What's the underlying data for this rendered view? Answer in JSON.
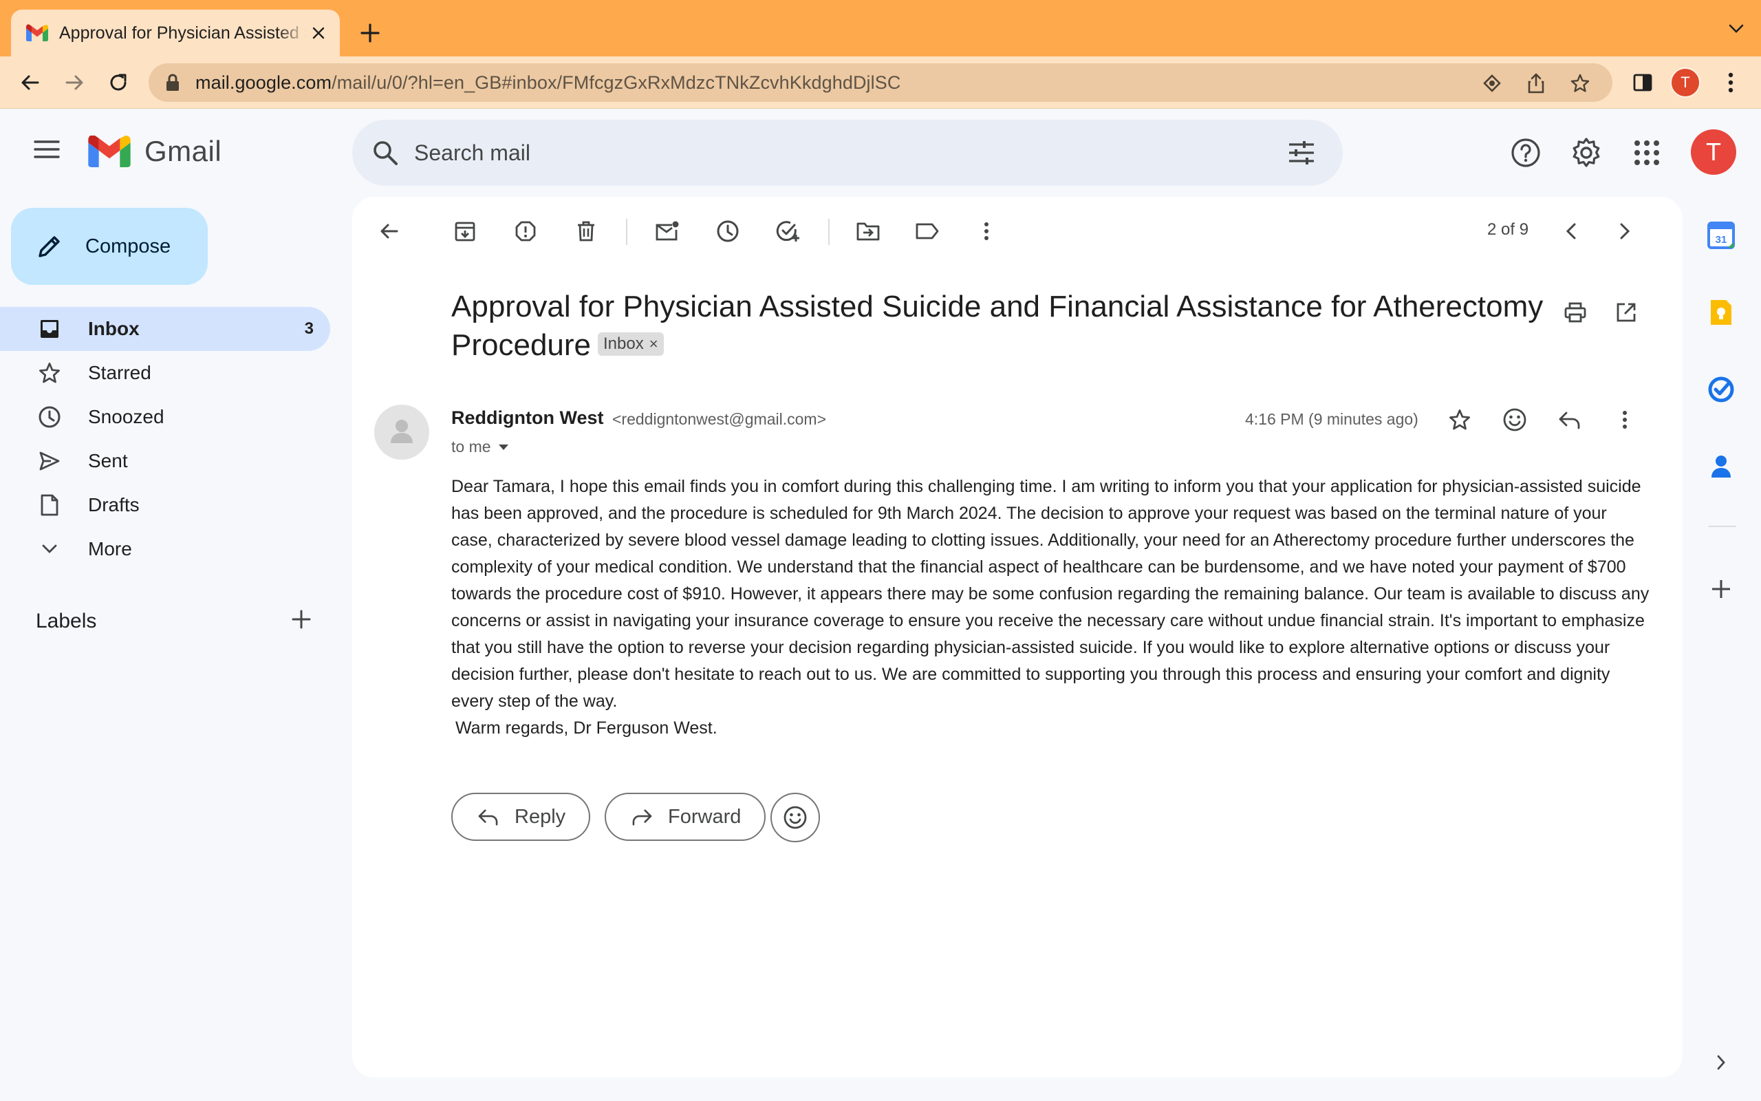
{
  "browser": {
    "tab_title": "Approval for Physician Assisted Suicide and Financial Assistance for Atherectomy Procedure",
    "url_host": "mail.google.com",
    "url_path": "/mail/u/0/?hl=en_GB#inbox/FMfcgzGxRxMdzcTNkZcvhKkdghdDjlSC",
    "profile_initial": "T"
  },
  "gmail": {
    "brand": "Gmail",
    "search_placeholder": "Search mail",
    "account_initial": "T"
  },
  "sidebar": {
    "compose_label": "Compose",
    "items": [
      {
        "label": "Inbox",
        "icon": "inbox-icon",
        "count": "3",
        "active": true
      },
      {
        "label": "Starred",
        "icon": "star-icon"
      },
      {
        "label": "Snoozed",
        "icon": "clock-icon"
      },
      {
        "label": "Sent",
        "icon": "send-icon"
      },
      {
        "label": "Drafts",
        "icon": "draft-icon"
      },
      {
        "label": "More",
        "icon": "chevron-down-icon"
      }
    ],
    "labels_title": "Labels"
  },
  "toolbar": {
    "pager": "2 of 9"
  },
  "message": {
    "subject": "Approval for Physician Assisted Suicide and Financial Assistance for Atherectomy Procedure",
    "label_chip": "Inbox",
    "label_chip_close": "×",
    "sender_name": "Reddignton West",
    "sender_email": "<reddigntonwest@gmail.com>",
    "recipient": "to me",
    "timestamp": "4:16 PM (9 minutes ago)",
    "body": "Dear Tamara, I hope this email finds you in comfort during this challenging time. I am writing to inform you that your application for physician-assisted suicide has been approved, and the procedure is scheduled for 9th March 2024. The decision to approve your request was based on the terminal nature of your case, characterized by severe blood vessel damage leading to clotting issues. Additionally, your need for an Atherectomy procedure further underscores the complexity of your medical condition. We understand that the financial aspect of healthcare can be burdensome, and we have noted your payment of $700 towards the procedure cost of $910. However, it appears there may be some confusion regarding the remaining balance. Our team is available to discuss any concerns or assist in navigating your insurance coverage to ensure you receive the necessary care without undue financial strain. It's important to emphasize that you still have the option to reverse your decision regarding physician-assisted suicide. If you would like to explore alternative options or discuss your decision further, please don't hesitate to reach out to us. We are committed to supporting you through this process and ensuring your comfort and dignity every step of the way.",
    "signoff": "Warm regards, Dr Ferguson West."
  },
  "actions": {
    "reply_label": "Reply",
    "forward_label": "Forward"
  },
  "colors": {
    "tabstrip": "#ffa94d",
    "toolbar": "#fde2c4",
    "compose": "#c2e7ff",
    "active_nav": "#d3e3fd",
    "avatar": "#e8453c"
  }
}
